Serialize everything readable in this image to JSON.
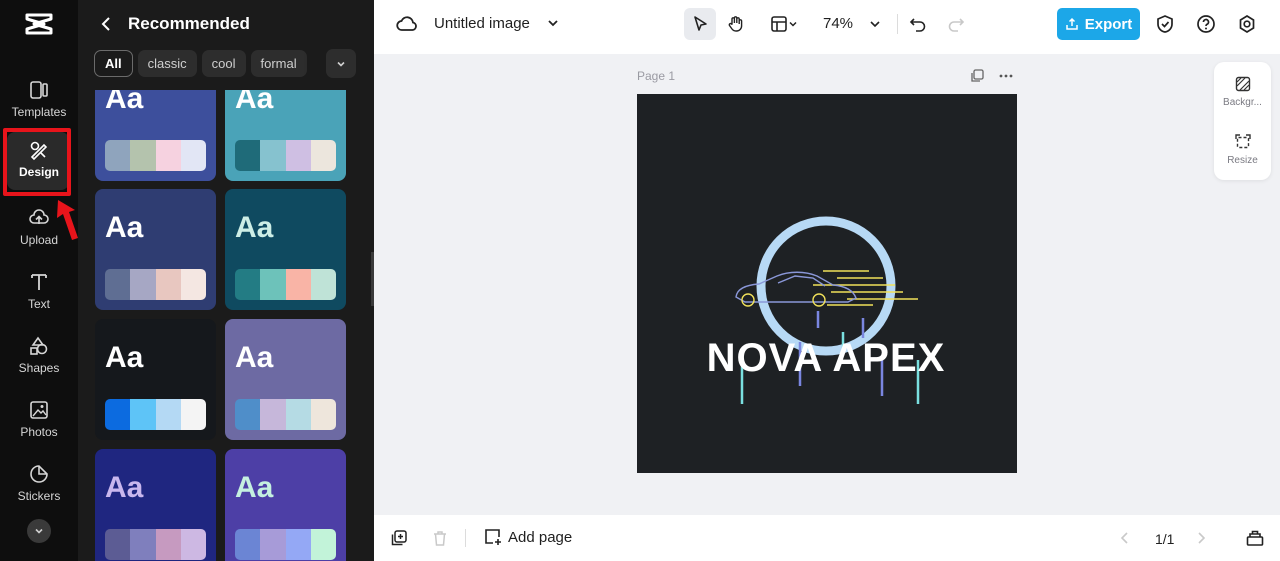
{
  "rail": {
    "items": [
      {
        "label": "Templates",
        "icon": "templates-icon"
      },
      {
        "label": "Design",
        "icon": "design-icon",
        "active": true
      },
      {
        "label": "Upload",
        "icon": "upload-icon"
      },
      {
        "label": "Text",
        "icon": "text-icon"
      },
      {
        "label": "Shapes",
        "icon": "shapes-icon"
      },
      {
        "label": "Photos",
        "icon": "photos-icon"
      },
      {
        "label": "Stickers",
        "icon": "stickers-icon"
      }
    ],
    "highlight_color": "#e8141b"
  },
  "panel": {
    "title": "Recommended",
    "chips": [
      "All",
      "classic",
      "cool",
      "formal"
    ],
    "card_label": "Aa",
    "cards": [
      {
        "bg": "#3d4f9c",
        "text": "#ffffff",
        "swatch": [
          "#8fa4bd",
          "#b4c3ad",
          "#f6d2e0",
          "#e2e6f5"
        ]
      },
      {
        "bg": "#4aa3b8",
        "text": "#ffffff",
        "swatch": [
          "#1f6b79",
          "#86c2cf",
          "#cfbfe3",
          "#ece6dd"
        ]
      },
      {
        "bg": "#2f3d72",
        "text": "#ffffff",
        "swatch": [
          "#5f6e93",
          "#a6a7c4",
          "#e8c7c0",
          "#f4e7e2"
        ]
      },
      {
        "bg": "#0f4a60",
        "text": "#cdeee6",
        "swatch": [
          "#237c84",
          "#6dc2ba",
          "#f9b4a6",
          "#bfe3d7"
        ]
      },
      {
        "bg": "#15181c",
        "text": "#ffffff",
        "swatch": [
          "#0c6be0",
          "#5ec4f7",
          "#b4d9f4",
          "#f4f4f4"
        ]
      },
      {
        "bg": "#6d6aa3",
        "text": "#ffffff",
        "swatch": [
          "#4f8ec9",
          "#c6b7da",
          "#b5dbe4",
          "#eee6dc"
        ]
      },
      {
        "bg": "#1f2680",
        "text": "#c9b7ee",
        "swatch": [
          "#5c5c94",
          "#7f7fbd",
          "#c69ac0",
          "#cdb8e3"
        ]
      },
      {
        "bg": "#4d3fa6",
        "text": "#c5f0e0",
        "swatch": [
          "#6b85d4",
          "#a79bd8",
          "#94a8f5",
          "#c2f3d9"
        ]
      }
    ]
  },
  "topbar": {
    "doc_title": "Untitled image",
    "zoom": "74%",
    "export_label": "Export"
  },
  "canvas": {
    "page_label": "Page 1",
    "logo_text": "NOVA APEX",
    "side_tools": [
      "Backgr...",
      "Resize"
    ]
  },
  "bottombar": {
    "add_page": "Add page",
    "page_count": "1/1"
  }
}
